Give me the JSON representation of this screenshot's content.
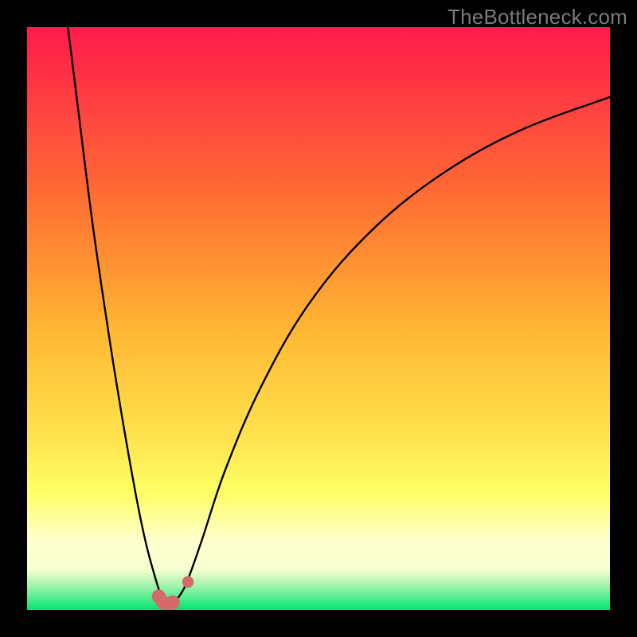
{
  "watermark": "TheBottleneck.com",
  "colors": {
    "gradient_top": "#ff1a4d",
    "gradient_mid1": "#ff7a2a",
    "gradient_mid2": "#ffd633",
    "gradient_mid3": "#ffff66",
    "gradient_pale": "#ffffcc",
    "gradient_bottom": "#00e673",
    "frame": "#000000",
    "curve": "#000000",
    "marker": "#d46a6a"
  },
  "chart_data": {
    "type": "line",
    "title": "",
    "xlabel": "",
    "ylabel": "",
    "xlim": [
      0,
      100
    ],
    "ylim": [
      0,
      100
    ],
    "series": [
      {
        "name": "left-curve",
        "x": [
          7,
          9,
          11,
          13,
          15,
          17,
          19,
          20.5,
          22,
          23,
          23.8,
          24.2
        ],
        "y": [
          100,
          84,
          68,
          54,
          41,
          29,
          18,
          11,
          5.5,
          2.4,
          1.2,
          1.0
        ]
      },
      {
        "name": "right-curve",
        "x": [
          24.2,
          25,
          26,
          27.5,
          30,
          34,
          40,
          48,
          58,
          70,
          84,
          100
        ],
        "y": [
          1.0,
          1.3,
          2.2,
          5.0,
          12,
          24,
          38,
          52,
          64,
          74,
          82,
          88
        ]
      }
    ],
    "markers": [
      {
        "name": "valley-marker-left",
        "x": 22.6,
        "y": 2.3,
        "r": 1.2
      },
      {
        "name": "valley-marker-mid1",
        "x": 23.3,
        "y": 1.3,
        "r": 1.2
      },
      {
        "name": "valley-marker-mid2",
        "x": 24.2,
        "y": 1.0,
        "r": 1.2
      },
      {
        "name": "valley-marker-mid3",
        "x": 25.0,
        "y": 1.3,
        "r": 1.2
      },
      {
        "name": "valley-marker-right",
        "x": 27.6,
        "y": 4.8,
        "r": 1.0
      }
    ],
    "gradient_stops": [
      {
        "offset": 0,
        "color": "#ff1a4d"
      },
      {
        "offset": 28,
        "color": "#ff6a33"
      },
      {
        "offset": 52,
        "color": "#ffb733"
      },
      {
        "offset": 70,
        "color": "#ffe24d"
      },
      {
        "offset": 80,
        "color": "#ffff66"
      },
      {
        "offset": 88,
        "color": "#ffffcc"
      },
      {
        "offset": 93,
        "color": "#f7ffd1"
      },
      {
        "offset": 96,
        "color": "#9cf2a9"
      },
      {
        "offset": 100,
        "color": "#00e673"
      }
    ]
  }
}
